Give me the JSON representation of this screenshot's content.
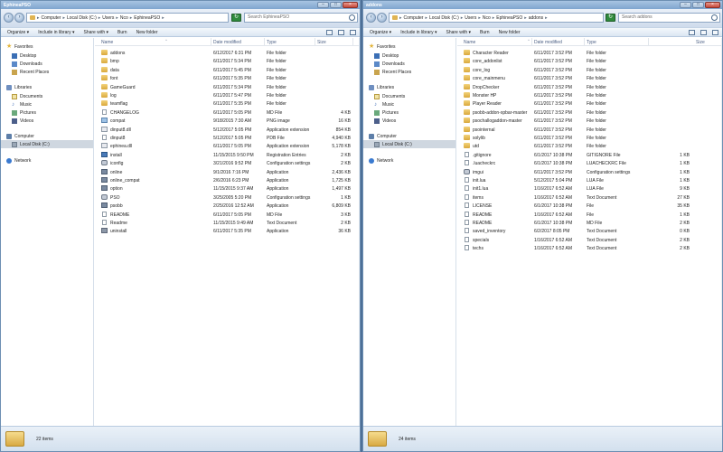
{
  "columns": {
    "name": "Name",
    "date": "Date modified",
    "type": "Type",
    "size": "Size"
  },
  "toolbar": {
    "organize": "Organize ▾",
    "include": "Include in library ▾",
    "share": "Share with ▾",
    "burn": "Burn",
    "new_folder": "New folder"
  },
  "nav": {
    "favorites": "Favorites",
    "desktop": "Desktop",
    "downloads": "Downloads",
    "recent": "Recent Places",
    "libraries": "Libraries",
    "documents": "Documents",
    "music": "Music",
    "pictures": "Pictures",
    "videos": "Videos",
    "computer": "Computer",
    "local_disk": "Local Disk (C:)",
    "network": "Network"
  },
  "left": {
    "title": "EphineaPSO",
    "breadcrumb": [
      "Computer",
      "Local Disk (C:)",
      "Users",
      "Nco",
      "EphineaPSO"
    ],
    "search_placeholder": "Search EphineaPSO",
    "status": "22 items",
    "files": [
      {
        "name": "addons",
        "date": "6/12/2017 6:31 PM",
        "type": "File folder",
        "size": "",
        "icon": "folder"
      },
      {
        "name": "bmp",
        "date": "6/11/2017 5:34 PM",
        "type": "File folder",
        "size": "",
        "icon": "folder"
      },
      {
        "name": "data",
        "date": "6/11/2017 5:45 PM",
        "type": "File folder",
        "size": "",
        "icon": "folder"
      },
      {
        "name": "font",
        "date": "6/11/2017 5:35 PM",
        "type": "File folder",
        "size": "",
        "icon": "folder"
      },
      {
        "name": "GameGuard",
        "date": "6/11/2017 5:34 PM",
        "type": "File folder",
        "size": "",
        "icon": "folder"
      },
      {
        "name": "log",
        "date": "6/11/2017 5:47 PM",
        "type": "File folder",
        "size": "",
        "icon": "folder"
      },
      {
        "name": "teamflag",
        "date": "6/11/2017 5:35 PM",
        "type": "File folder",
        "size": "",
        "icon": "folder"
      },
      {
        "name": "CHANGELOG",
        "date": "6/11/2017 5:05 PM",
        "type": "MD File",
        "size": "4 KB",
        "icon": "file"
      },
      {
        "name": "compat",
        "date": "9/18/2015 7:30 AM",
        "type": "PNG image",
        "size": "16 KB",
        "icon": "png"
      },
      {
        "name": "dinput8.dll",
        "date": "5/12/2017 5:05 PM",
        "type": "Application extension",
        "size": "854 KB",
        "icon": "dll"
      },
      {
        "name": "dinput8",
        "date": "5/12/2017 5:05 PM",
        "type": "PDB File",
        "size": "4,940 KB",
        "icon": "file"
      },
      {
        "name": "ephinea.dll",
        "date": "6/11/2017 5:05 PM",
        "type": "Application extension",
        "size": "5,178 KB",
        "icon": "dll"
      },
      {
        "name": "install",
        "date": "11/15/2015 9:50 PM",
        "type": "Registration Entries",
        "size": "2 KB",
        "icon": "reg"
      },
      {
        "name": "iconfig",
        "date": "3/21/2016 9:52 PM",
        "type": "Configuration settings",
        "size": "2 KB",
        "icon": "gear"
      },
      {
        "name": "online",
        "date": "9/1/2016 7:16 PM",
        "type": "Application",
        "size": "2,436 KB",
        "icon": "exe"
      },
      {
        "name": "online_compat",
        "date": "2/6/2016 6:23 PM",
        "type": "Application",
        "size": "1,725 KB",
        "icon": "exe"
      },
      {
        "name": "option",
        "date": "11/15/2015 9:37 AM",
        "type": "Application",
        "size": "1,497 KB",
        "icon": "exe"
      },
      {
        "name": "PSO",
        "date": "3/25/2005 5:20 PM",
        "type": "Configuration settings",
        "size": "1 KB",
        "icon": "gear"
      },
      {
        "name": "psobb",
        "date": "2/25/2016 12:52 AM",
        "type": "Application",
        "size": "6,809 KB",
        "icon": "exe"
      },
      {
        "name": "README",
        "date": "6/11/2017 5:05 PM",
        "type": "MD File",
        "size": "3 KB",
        "icon": "file"
      },
      {
        "name": "Readme",
        "date": "11/15/2015 9:49 AM",
        "type": "Text Document",
        "size": "2 KB",
        "icon": "txt"
      },
      {
        "name": "uninstall",
        "date": "6/11/2017 5:35 PM",
        "type": "Application",
        "size": "36 KB",
        "icon": "uninst"
      }
    ]
  },
  "right": {
    "title": "addons",
    "breadcrumb": [
      "Computer",
      "Local Disk (C:)",
      "Users",
      "Nco",
      "EphineaPSO",
      "addons"
    ],
    "search_placeholder": "Search addons",
    "status": "24 items",
    "files": [
      {
        "name": "Character Reader",
        "date": "6/11/2017 3:52 PM",
        "type": "File folder",
        "size": "",
        "icon": "folder"
      },
      {
        "name": "core_addonlist",
        "date": "6/11/2017 3:52 PM",
        "type": "File folder",
        "size": "",
        "icon": "folder"
      },
      {
        "name": "core_log",
        "date": "6/11/2017 3:52 PM",
        "type": "File folder",
        "size": "",
        "icon": "folder"
      },
      {
        "name": "core_mainmenu",
        "date": "6/11/2017 3:52 PM",
        "type": "File folder",
        "size": "",
        "icon": "folder"
      },
      {
        "name": "DropChecker",
        "date": "6/11/2017 3:52 PM",
        "type": "File folder",
        "size": "",
        "icon": "folder"
      },
      {
        "name": "Monster HP",
        "date": "6/11/2017 3:52 PM",
        "type": "File folder",
        "size": "",
        "icon": "folder"
      },
      {
        "name": "Player Reader",
        "date": "6/11/2017 3:52 PM",
        "type": "File folder",
        "size": "",
        "icon": "folder"
      },
      {
        "name": "psobb-addon-xpbar-master",
        "date": "6/11/2017 3:52 PM",
        "type": "File folder",
        "size": "",
        "icon": "folder"
      },
      {
        "name": "psochallogaddon-master",
        "date": "6/11/2017 3:52 PM",
        "type": "File folder",
        "size": "",
        "icon": "folder"
      },
      {
        "name": "psointernal",
        "date": "6/11/2017 3:52 PM",
        "type": "File folder",
        "size": "",
        "icon": "folder"
      },
      {
        "name": "solylib",
        "date": "6/11/2017 3:52 PM",
        "type": "File folder",
        "size": "",
        "icon": "folder"
      },
      {
        "name": "utd",
        "date": "6/11/2017 3:52 PM",
        "type": "File folder",
        "size": "",
        "icon": "folder"
      },
      {
        "name": ".gitignore",
        "date": "6/1/2017 10:38 PM",
        "type": "GITIGNORE File",
        "size": "1 KB",
        "icon": "file"
      },
      {
        "name": ".luacheckrc",
        "date": "6/1/2017 10:38 PM",
        "type": "LUACHECKRC File",
        "size": "1 KB",
        "icon": "file"
      },
      {
        "name": "imgui",
        "date": "6/11/2017 3:52 PM",
        "type": "Configuration settings",
        "size": "1 KB",
        "icon": "gear"
      },
      {
        "name": "init.lua",
        "date": "5/12/2017 5:04 PM",
        "type": "LUA File",
        "size": "1 KB",
        "icon": "file"
      },
      {
        "name": "init1.lua",
        "date": "1/16/2017 6:52 AM",
        "type": "LUA File",
        "size": "9 KB",
        "icon": "file"
      },
      {
        "name": "items",
        "date": "1/16/2017 6:52 AM",
        "type": "Text Document",
        "size": "27 KB",
        "icon": "txt"
      },
      {
        "name": "LICENSE",
        "date": "6/1/2017 10:38 PM",
        "type": "File",
        "size": "35 KB",
        "icon": "file"
      },
      {
        "name": "README",
        "date": "1/16/2017 6:52 AM",
        "type": "File",
        "size": "1 KB",
        "icon": "file"
      },
      {
        "name": "README",
        "date": "6/1/2017 10:38 PM",
        "type": "MD File",
        "size": "2 KB",
        "icon": "file"
      },
      {
        "name": "saved_inventory",
        "date": "6/2/2017 8:05 PM",
        "type": "Text Document",
        "size": "0 KB",
        "icon": "txt"
      },
      {
        "name": "specials",
        "date": "1/16/2017 6:52 AM",
        "type": "Text Document",
        "size": "2 KB",
        "icon": "txt"
      },
      {
        "name": "techs",
        "date": "1/16/2017 6:52 AM",
        "type": "Text Document",
        "size": "2 KB",
        "icon": "txt"
      }
    ]
  }
}
